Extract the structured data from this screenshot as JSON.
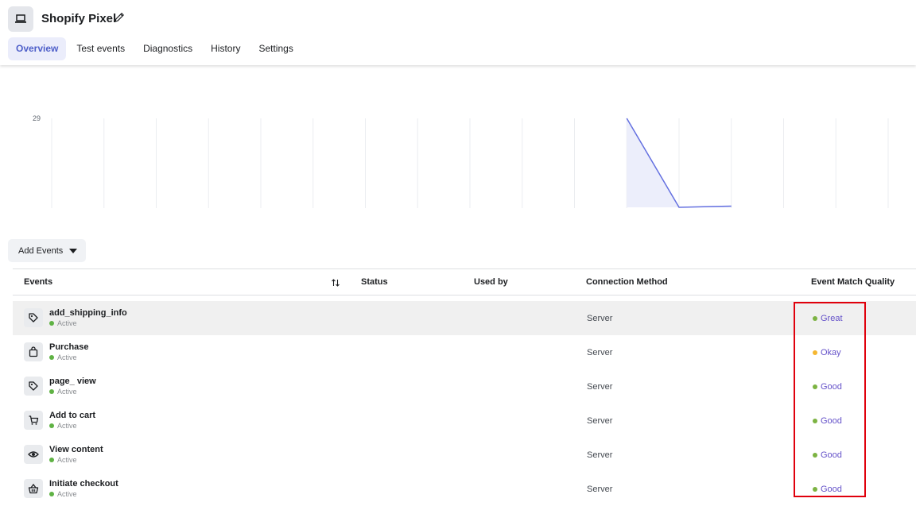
{
  "header": {
    "title": "Shopify Pixel",
    "app_icon": "laptop-icon",
    "edit_icon": "pencil-icon"
  },
  "tabs": [
    {
      "label": "Overview",
      "active": true
    },
    {
      "label": "Test events",
      "active": false
    },
    {
      "label": "Diagnostics",
      "active": false
    },
    {
      "label": "History",
      "active": false
    },
    {
      "label": "Settings",
      "active": false
    }
  ],
  "chart_data": {
    "type": "area",
    "y_tick_labels": [
      "29"
    ],
    "ylim": [
      0,
      29
    ],
    "x_points": 17,
    "series": [
      {
        "values": [
          null,
          null,
          null,
          null,
          null,
          null,
          null,
          null,
          null,
          null,
          null,
          29,
          0,
          0.4,
          null,
          null,
          null
        ],
        "color": "#6470e0",
        "fill": "#eceefb"
      }
    ],
    "grid": true
  },
  "add_events": {
    "label": "Add Events"
  },
  "table": {
    "headers": {
      "events": "Events",
      "status": "Status",
      "used_by": "Used by",
      "connection_method": "Connection Method",
      "match_quality": "Event Match Quality"
    },
    "rows": [
      {
        "name": "add_shipping_info",
        "status": "Active",
        "method": "Server",
        "quality": "Great",
        "quality_color": "#7cb342",
        "icon": "tag-icon",
        "highlighted": true
      },
      {
        "name": "Purchase",
        "status": "Active",
        "method": "Server",
        "quality": "Okay",
        "quality_color": "#f5b731",
        "icon": "shopping-bag-icon",
        "highlighted": false
      },
      {
        "name": "page_ view",
        "status": "Active",
        "method": "Server",
        "quality": "Good",
        "quality_color": "#7cb342",
        "icon": "tag-icon",
        "highlighted": false
      },
      {
        "name": "Add to cart",
        "status": "Active",
        "method": "Server",
        "quality": "Good",
        "quality_color": "#7cb342",
        "icon": "cart-icon",
        "highlighted": false
      },
      {
        "name": "View content",
        "status": "Active",
        "method": "Server",
        "quality": "Good",
        "quality_color": "#7cb342",
        "icon": "eye-icon",
        "highlighted": false
      },
      {
        "name": "Initiate checkout",
        "status": "Active",
        "method": "Server",
        "quality": "Good",
        "quality_color": "#7cb342",
        "icon": "basket-icon",
        "highlighted": false
      }
    ]
  },
  "colors": {
    "active_dot": "#5fb244",
    "accent": "#4e5fc9",
    "highlight_box": "#e0000c"
  }
}
